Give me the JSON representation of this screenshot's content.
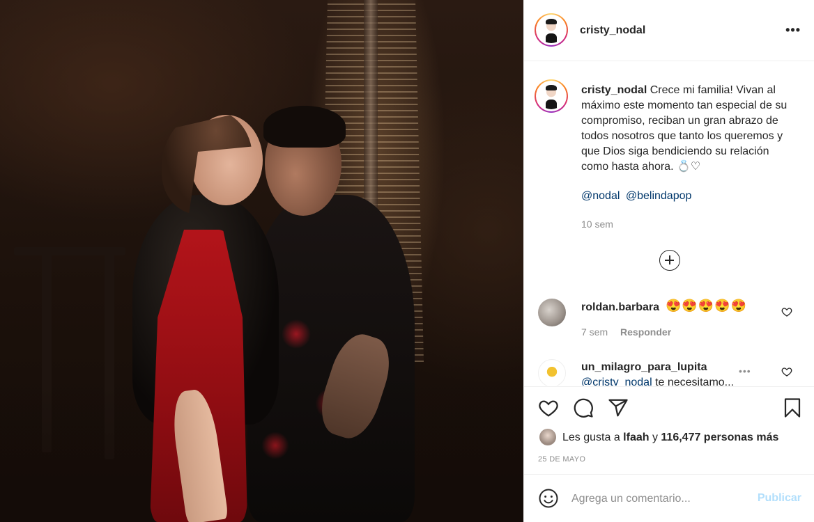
{
  "post": {
    "username": "cristy_nodal",
    "more_icon": "more-horizontal-icon",
    "photo_alt": "couple photo"
  },
  "caption": {
    "username": "cristy_nodal",
    "text": "Crece mi familia! Vivan al máximo este momento tan especial de su compromiso, reciban un gran abrazo de todos nosotros que tanto los queremos y que Dios siga bendiciendo su relación como hasta ahora. 💍♡",
    "mentions": [
      "@nodal",
      "@belindapop"
    ],
    "time": "10 sem"
  },
  "load_more_icon": "plus-circle-icon",
  "comments": [
    {
      "username": "roldan.barbara",
      "text": "😍😍😍😍😍",
      "time": "7 sem",
      "reply_label": "Responder"
    },
    {
      "username": "un_milagro_para_lupita",
      "mention": "@cristy_nodal",
      "text": " te necesitamo..."
    }
  ],
  "actions": {
    "icons": [
      "heart-icon",
      "comment-icon",
      "share-icon",
      "bookmark-icon"
    ]
  },
  "likes": {
    "prefix": "Les gusta a ",
    "user": "lfaah",
    "middle": " y ",
    "count": "116,477 personas más"
  },
  "date": "25 DE MAYO",
  "add_comment": {
    "placeholder": "Agrega un comentario...",
    "publish_label": "Publicar"
  },
  "colors": {
    "text": "#262626",
    "muted": "#8e8e8e",
    "link": "#00376b",
    "publish_disabled": "#b2dffc"
  }
}
